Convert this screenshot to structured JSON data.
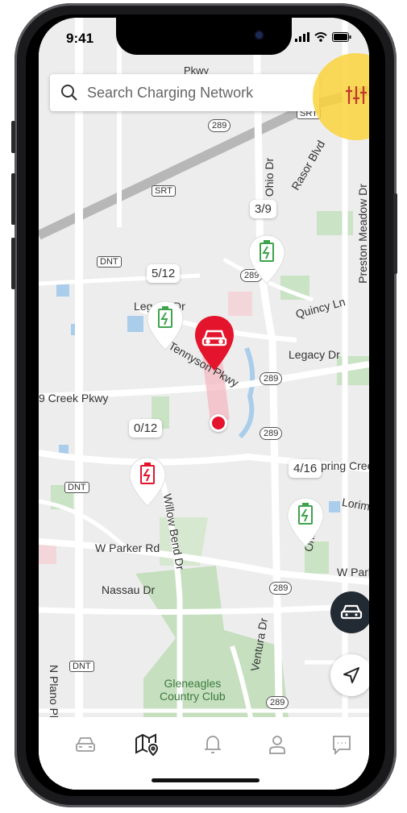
{
  "status_bar": {
    "time": "9:41"
  },
  "search": {
    "placeholder": "Search Charging Network"
  },
  "stations": [
    {
      "count": "3/9",
      "status": "available",
      "color": "#3fa34d"
    },
    {
      "count": "5/12",
      "status": "available",
      "color": "#3fa34d"
    },
    {
      "count": "0/12",
      "status": "unavailable",
      "color": "#e3142b"
    },
    {
      "count": "4/16",
      "status": "available",
      "color": "#3fa34d"
    }
  ],
  "map_labels": {
    "street_tennyson": "Tennyson Pkwy",
    "street_legacy_dr": "Legacy Dr",
    "street_legacy_dr_left": "Legacy Dr",
    "street_quincy": "Quincy Ln",
    "street_rasor": "Rasor Blvd",
    "street_ohio_top": "Ohio Dr",
    "street_ohio_bottom": "Ohio",
    "street_preston_meadow": "Preston Meadow Dr",
    "street_creek_left": "9 Creek Pkwy",
    "street_spring_creek": "pring Creek P",
    "street_lorimar": "Lorimar D",
    "street_willow_bend": "Willow Bend Dr",
    "street_w_parker": "W Parker Rd",
    "street_w_parker_right": "W Parker R",
    "street_nassau": "Nassau Dr",
    "street_ventura": "Ventura Dr",
    "street_plano": "N Plano Pk",
    "street_pkwy_top": "Pkwy",
    "park_name": "Gleneagles\nCountry Club",
    "shield_srt_top": "SRT",
    "shield_srt_mid": "SRT",
    "shield_dnt_top": "DNT",
    "shield_dnt_mid": "DNT",
    "shield_dnt_bot": "DNT",
    "hwy_289_a": "289",
    "hwy_289_b": "289",
    "hwy_289_c": "289",
    "hwy_289_d": "289",
    "hwy_289_e": "289",
    "hwy_289_f": "289"
  },
  "colors": {
    "accent_red": "#e3142b",
    "available_green": "#3fa34d",
    "highlight_yellow": "#fad23c",
    "fab_dark": "#222a33"
  },
  "icons": {
    "search": "search-icon",
    "filter": "sliders-icon",
    "vehicle_fab": "car-icon",
    "locate_fab": "navigation-arrow-icon",
    "tabs": [
      "car-icon",
      "map-pin-icon",
      "bell-icon",
      "user-icon",
      "chat-icon"
    ]
  },
  "tabs": {
    "active_index": 1
  }
}
